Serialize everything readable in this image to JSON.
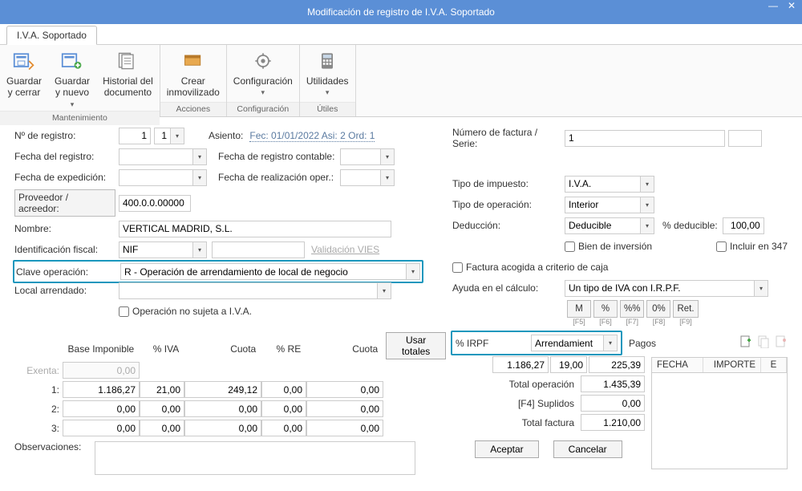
{
  "window": {
    "title": "Modificación de registro de I.V.A. Soportado"
  },
  "tab": {
    "label": "I.V.A. Soportado"
  },
  "ribbon": {
    "guardar_cerrar": "Guardar\ny cerrar",
    "guardar_nuevo": "Guardar\ny nuevo",
    "historial": "Historial del\ndocumento",
    "crear_inmov": "Crear\ninmovilizado",
    "config": "Configuración",
    "utilidades": "Utilidades",
    "group_mant": "Mantenimiento",
    "group_acc": "Acciones",
    "group_conf": "Configuración",
    "group_util": "Útiles"
  },
  "left": {
    "n_registro": "Nº de registro:",
    "n_registro_v1": "1",
    "n_registro_v2": "1",
    "asiento": "Asiento:",
    "asiento_val": "Fec: 01/01/2022 Asi: 2 Ord: 1",
    "fecha_registro": "Fecha del registro:",
    "fecha_reg_contable": "Fecha de registro contable:",
    "fecha_expedicion": "Fecha de expedición:",
    "fecha_realizacion": "Fecha de realización oper.:",
    "prov_acreedor": "Proveedor / acreedor:",
    "prov_val": "400.0.0.00000",
    "nombre": "Nombre:",
    "nombre_val": "VERTICAL MADRID, S.L.",
    "id_fiscal": "Identificación fiscal:",
    "id_fiscal_val": "NIF",
    "valid_vies": "Validación VIES",
    "clave_op": "Clave operación:",
    "clave_op_val": "R - Operación de arrendamiento de local de negocio",
    "local_arrendado": "Local arrendado:",
    "op_no_sujeta": "Operación no sujeta a I.V.A.",
    "observaciones": "Observaciones:"
  },
  "right": {
    "num_factura": "Número de factura / Serie:",
    "num_factura_val": "1",
    "tipo_impuesto": "Tipo de impuesto:",
    "tipo_impuesto_val": "I.V.A.",
    "tipo_operacion": "Tipo de operación:",
    "tipo_operacion_val": "Interior",
    "deduccion": "Deducción:",
    "deduccion_val": "Deducible",
    "pct_deducible": "% deducible:",
    "pct_deducible_val": "100,00",
    "bien_inversion": "Bien de inversión",
    "incluir_347": "Incluir en 347",
    "factura_caja": "Factura acogida a criterio de caja",
    "ayuda_calculo": "Ayuda en el cálculo:",
    "ayuda_calculo_val": "Un tipo de IVA con I.R.P.F.",
    "btn_m": "M",
    "btn_pct": "%",
    "btn_pctpct": "%%",
    "btn_0pct": "0%",
    "btn_ret": "Ret.",
    "f5": "[F5]",
    "f6": "[F6]",
    "f7": "[F7]",
    "f8": "[F8]",
    "f9": "[F9]",
    "pct_irpf": "% IRPF",
    "irpf_tipo": "Arrendamient",
    "pagos": "Pagos",
    "col_fecha": "FECHA",
    "col_importe": "IMPORTE",
    "col_e": "E"
  },
  "grid": {
    "hdr_base": "Base Imponible",
    "hdr_iva": "% IVA",
    "hdr_cuota": "Cuota",
    "hdr_re": "% RE",
    "hdr_cuota2": "Cuota",
    "usar_totales": "Usar totales",
    "exenta": "Exenta:",
    "exenta_v": "0,00",
    "r1": "1:",
    "r1_base": "1.186,27",
    "r1_iva": "21,00",
    "r1_cuota": "249,12",
    "r1_re": "0,00",
    "r1_cuota2": "0,00",
    "r2": "2:",
    "r2_base": "0,00",
    "r2_iva": "0,00",
    "r2_cuota": "0,00",
    "r2_re": "0,00",
    "r2_cuota2": "0,00",
    "r3": "3:",
    "r3_base": "0,00",
    "r3_iva": "0,00",
    "r3_cuota": "0,00",
    "r3_re": "0,00",
    "r3_cuota2": "0,00"
  },
  "totals": {
    "irpf_base": "1.186,27",
    "irpf_pct": "19,00",
    "irpf_cuota": "225,39",
    "total_op": "Total operación",
    "total_op_v": "1.435,39",
    "suplidos": "[F4] Suplidos",
    "suplidos_v": "0,00",
    "total_factura": "Total factura",
    "total_factura_v": "1.210,00"
  },
  "buttons": {
    "aceptar": "Aceptar",
    "cancelar": "Cancelar"
  }
}
